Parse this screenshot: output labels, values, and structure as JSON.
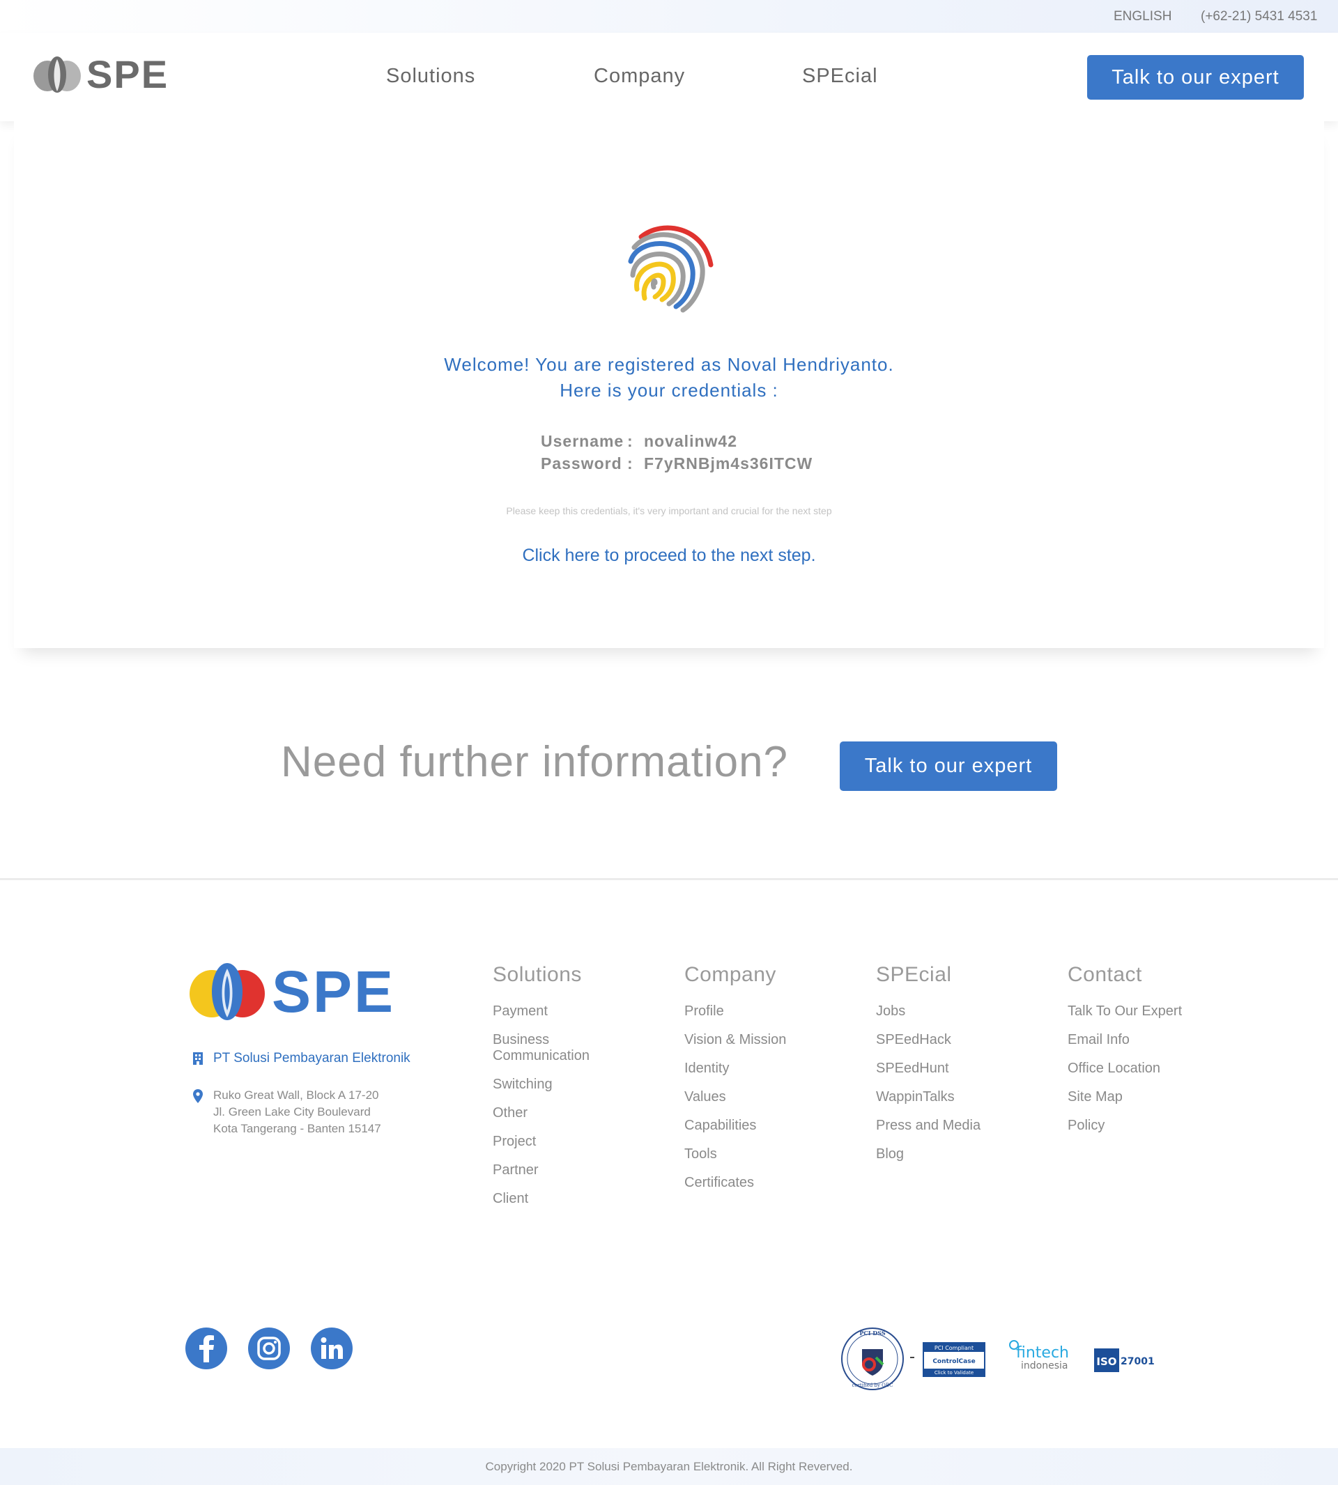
{
  "topbar": {
    "language": "ENGLISH",
    "phone": "(+62-21) 5431 4531"
  },
  "header": {
    "logo_text": "SPE",
    "nav": [
      "Solutions",
      "Company",
      "SPEcial"
    ],
    "cta_label": "Talk to our expert"
  },
  "main": {
    "welcome_line1": "Welcome! You are registered as Noval Hendriyanto.",
    "welcome_line2": "Here is your credentials :",
    "username_label": "Username",
    "username_sep": ":",
    "username_value": "novalinw42",
    "password_label": "Password",
    "password_sep": ":",
    "password_value": "F7yRNBjm4s36ITCW",
    "note": "Please keep this credentials, it's very important and crucial for the next step",
    "proceed_link": "Click here to proceed to the next step."
  },
  "cta": {
    "heading": "Need further information?",
    "button_label": "Talk to our expert"
  },
  "footer": {
    "logo_text": "SPE",
    "company_name": "PT Solusi Pembayaran Elektronik",
    "address": [
      "Ruko Great Wall, Block A 17-20",
      "Jl. Green Lake City Boulevard",
      "Kota Tangerang - Banten 15147"
    ],
    "columns": [
      {
        "title": "Solutions",
        "items": [
          "Payment",
          "Business Communication",
          "Switching",
          "Other",
          "Project",
          "Partner",
          "Client"
        ]
      },
      {
        "title": "Company",
        "items": [
          "Profile",
          "Vision & Mission",
          "Identity",
          "Values",
          "Capabilities",
          "Tools",
          "Certificates"
        ]
      },
      {
        "title": "SPEcial",
        "items": [
          "Jobs",
          "SPEedHack",
          "SPEedHunt",
          "WappinTalks",
          "Press and Media",
          "Blog"
        ]
      },
      {
        "title": "Contact",
        "items": [
          "Talk To Our Expert",
          "Email Info",
          "Office Location",
          "Site Map",
          "Policy"
        ]
      }
    ],
    "social": [
      "facebook-icon",
      "instagram-icon",
      "linkedin-icon"
    ],
    "badges": {
      "pci_top": "PCI DSS",
      "pci_bottom": "certified by QBC",
      "controlcase_top": "PCI Compliant",
      "controlcase_mid": "ControlCase",
      "controlcase_bottom": "Click to Validate",
      "fintech_top": "fintech",
      "fintech_bottom": "indonesia",
      "iso_left": "ISO",
      "iso_right": "27001"
    },
    "copyright": "Copyright 2020 PT Solusi Pembayaran Elektronik. All Right Reverved."
  },
  "colors": {
    "brand_blue": "#3b78c9",
    "link_blue": "#2f6fbf",
    "logo_red": "#e0332f",
    "logo_yellow": "#f4c61d",
    "logo_gray": "#6b6b6b"
  }
}
